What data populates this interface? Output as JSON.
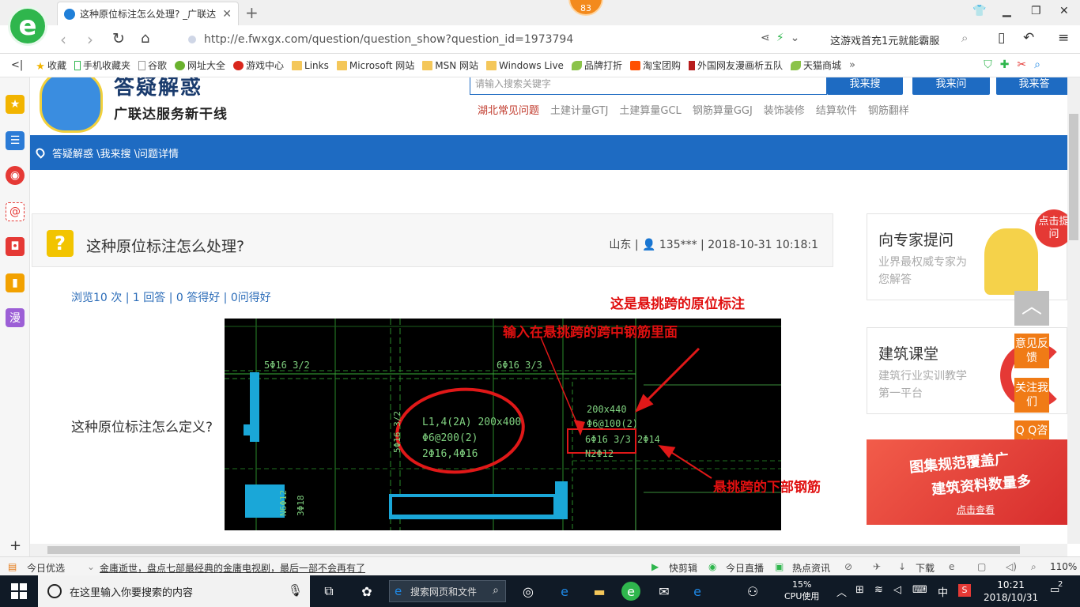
{
  "browser": {
    "tab_title": "这种原位标注怎么处理? _广联达",
    "tab_close": "✕",
    "new_tab": "+",
    "badge": "83",
    "url": "http://e.fwxgx.com/question/question_show?question_id=1973794",
    "search_hint": "这游戏首充1元就能霸服",
    "logo_letter": "e"
  },
  "bookmarks": [
    {
      "label": "收藏",
      "icon": "star-icon"
    },
    {
      "label": "手机收藏夹",
      "icon": "phone-icon"
    },
    {
      "label": "谷歌",
      "icon": "page-icon"
    },
    {
      "label": "网址大全",
      "icon": "globe-icon"
    },
    {
      "label": "游戏中心",
      "icon": "game-icon"
    },
    {
      "label": "Links",
      "icon": "folder-icon"
    },
    {
      "label": "Microsoft 网站",
      "icon": "folder-icon"
    },
    {
      "label": "MSN 网站",
      "icon": "folder-icon"
    },
    {
      "label": "Windows Live",
      "icon": "folder-icon"
    },
    {
      "label": "品牌打折",
      "icon": "leaf-icon"
    },
    {
      "label": "淘宝团购",
      "icon": "taobao-icon"
    },
    {
      "label": "外国网友漫画析五队",
      "icon": "bookmark-icon"
    },
    {
      "label": "天猫商城",
      "icon": "leaf-icon"
    }
  ],
  "site": {
    "logo_title": "答疑解惑",
    "logo_sub": "广联达服务新干线",
    "search_placeholder": "请输入搜索关键字",
    "btn_search": "我来搜",
    "btn_ask": "我来问",
    "btn_answer": "我来答",
    "categories": [
      "湖北常见问题",
      "土建计量GTJ",
      "土建算量GCL",
      "钢筋算量GGJ",
      "装饰装修",
      "结算软件",
      "钢筋翻样"
    ],
    "breadcrumb": "答疑解惑 \\我来搜 \\问题详情"
  },
  "question": {
    "icon": "?",
    "title": "这种原位标注怎么处理?",
    "meta": "山东 | 👤 135*** | 2018-10-31 10:18:1",
    "stats": "浏览10 次 | 1 回答 | 0 答得好 | 0问得好",
    "body": "这种原位标注怎么定义?"
  },
  "annotations": {
    "a1": "这是悬挑跨的原位标注",
    "a2": "输入在悬挑跨的跨中钢筋里面",
    "a3": "悬挑跨的下部钢筋"
  },
  "cad_text": {
    "t1": "5Φ16 3/2",
    "t2": "6Φ16 3/3",
    "t3": "L1,4(2A) 200x400",
    "t4": "Φ6@200(2)",
    "t5": "2Φ16,4Φ16",
    "t6": "200x440",
    "t7": "Φ6@100(2)",
    "t8": "6Φ16 3/3",
    "t9": "2Φ14",
    "t10": "N2Φ12",
    "t11": "5Φ16 3/2",
    "t12": "3Φ18",
    "t13": "N6Φ12"
  },
  "right": {
    "card1_title": "向专家提问",
    "card1_sub": "业界最权威专家为您解答",
    "card1_bubble": "点击提问",
    "card2_title": "建筑课堂",
    "card2_sub": "建筑行业实训教学第一平台",
    "float1": "意见反馈",
    "float2": "关注我们",
    "float3": "Q Q咨询",
    "ad_line1": "图集规范覆盖广",
    "ad_line2": "建筑资料数量多",
    "ad_btn": "点击查看"
  },
  "statusbar": {
    "today": "今日优选",
    "news": "金庸逝世，盘点七部最经典的金庸电视剧，最后一部不会再有了",
    "kuaijian": "快剪辑",
    "live": "今日直播",
    "hot": "热点资讯",
    "download": "下载",
    "zoom": "110%"
  },
  "taskbar": {
    "search_placeholder": "在这里输入你要搜索的内容",
    "web_search": "搜索网页和文件",
    "cpu_pct": "15%",
    "cpu_label": "CPU使用",
    "ime": "中",
    "time": "10:21",
    "date": "2018/10/31",
    "notif": "2"
  }
}
